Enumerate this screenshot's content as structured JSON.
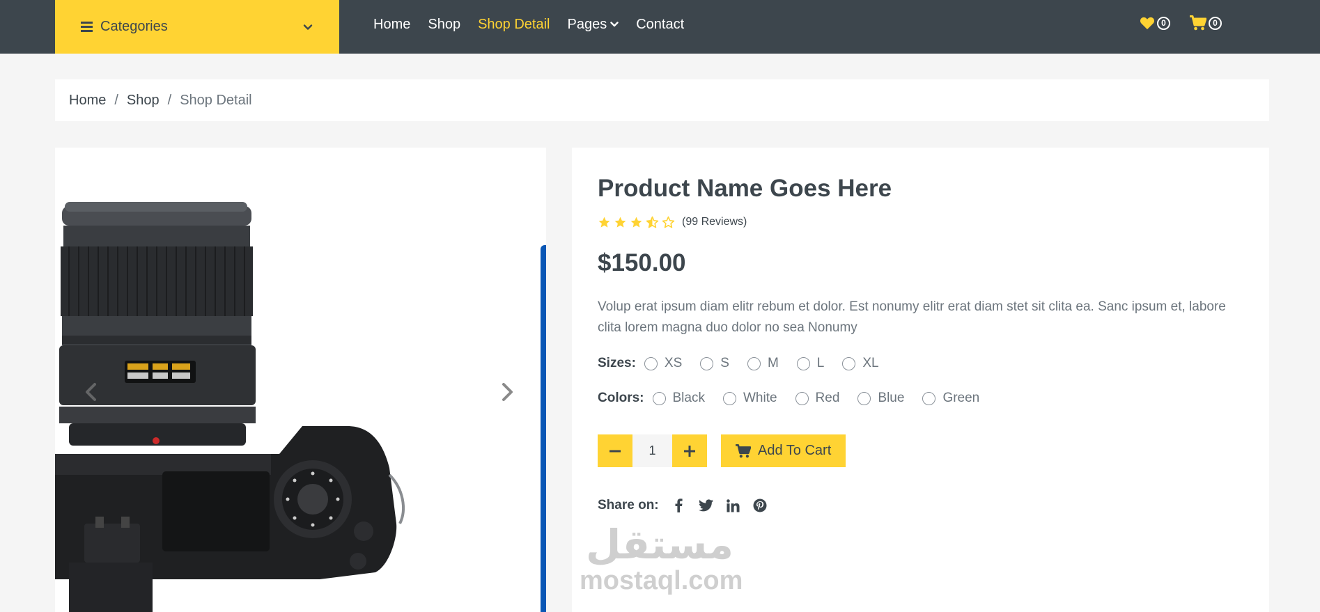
{
  "navbar": {
    "categories_label": "Categories",
    "links": [
      {
        "label": "Home"
      },
      {
        "label": "Shop"
      },
      {
        "label": "Shop Detail",
        "active": true
      },
      {
        "label": "Pages"
      },
      {
        "label": "Contact"
      }
    ],
    "wishlist_count": "0",
    "cart_count": "0"
  },
  "breadcrumb": {
    "home": "Home",
    "shop": "Shop",
    "current": "Shop Detail",
    "separator": "/"
  },
  "product": {
    "name": "Product Name Goes Here",
    "rating": 3.5,
    "rating_max": 5,
    "reviews": "(99 Reviews)",
    "price": "$150.00",
    "description": "Volup erat ipsum diam elitr rebum et dolor. Est nonumy elitr erat diam stet sit clita ea. Sanc ipsum et, labore clita lorem magna duo dolor no sea Nonumy",
    "sizes_label": "Sizes:",
    "sizes": [
      "XS",
      "S",
      "M",
      "L",
      "XL"
    ],
    "colors_label": "Colors:",
    "colors": [
      "Black",
      "White",
      "Red",
      "Blue",
      "Green"
    ],
    "quantity": "1",
    "add_to_cart": "Add To Cart",
    "share_label": "Share on:"
  },
  "theme": {
    "accent": "#ffd333",
    "dark": "#3d464d",
    "muted": "#6c757d",
    "background": "#f5f5f5"
  },
  "icons": {
    "menu": "bars-icon",
    "dropdown": "chevron-down-icon",
    "wishlist": "heart-icon",
    "cart": "shopping-cart-icon",
    "prev": "chevron-left-icon",
    "next": "chevron-right-icon",
    "minus": "minus-icon",
    "plus": "plus-icon",
    "social": [
      "facebook-icon",
      "twitter-icon",
      "linkedin-icon",
      "pinterest-icon"
    ]
  },
  "watermark": {
    "arabic": "مستقل",
    "latin": "mostaql.com"
  }
}
